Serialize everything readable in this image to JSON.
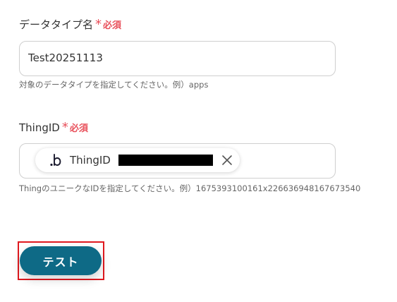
{
  "fields": [
    {
      "label": "データタイプ名",
      "required_mark": "*",
      "required_text": "必須",
      "value": "Test20251113",
      "hint": "対象のデータタイプを指定してください。例）apps"
    },
    {
      "label": "ThingID",
      "required_mark": "*",
      "required_text": "必須",
      "chip": {
        "icon": "b-logo-icon",
        "label": "ThingID",
        "value_redacted": true
      },
      "hint": "ThingのユニークなIDを指定してください。例）1675393100161x226636948167673540"
    }
  ],
  "test_button": {
    "label": "テスト",
    "color": "#0e6a86",
    "highlight_color": "#e0191f"
  },
  "colors": {
    "required": "#e8505b",
    "border": "#cfcfcf"
  }
}
